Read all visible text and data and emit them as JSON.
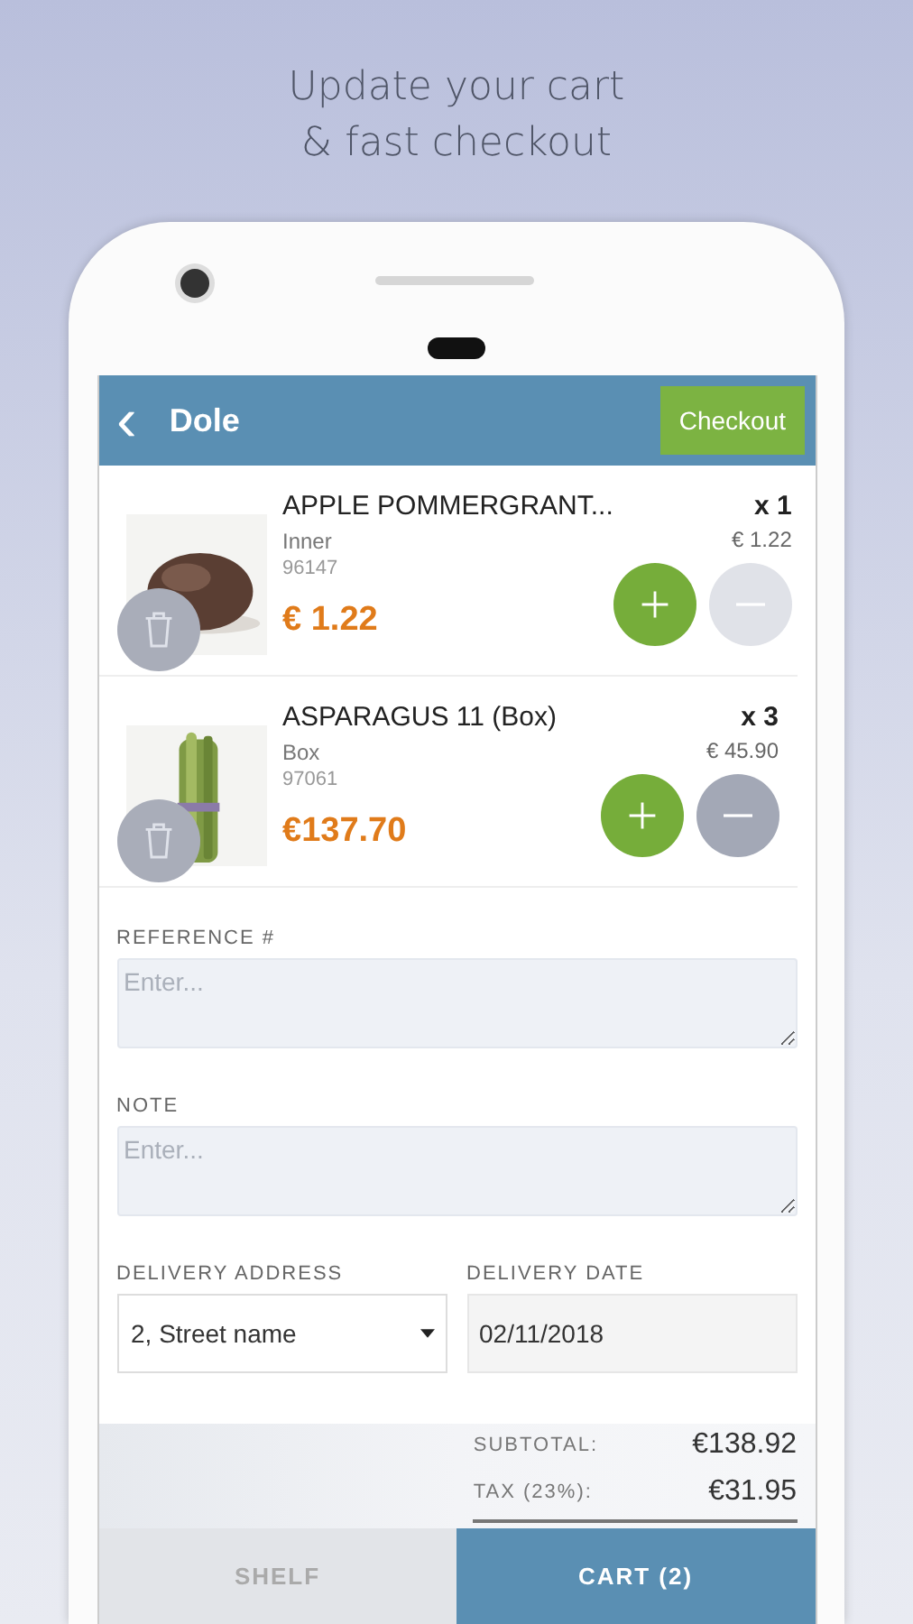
{
  "headline": [
    "Update your cart",
    "& fast checkout"
  ],
  "app_bar": {
    "back_icon": "‹",
    "title": "Dole",
    "checkout_button": "Checkout"
  },
  "cart_items": [
    {
      "name": "APPLE POMMERGRANT...",
      "unit": "Inner",
      "code": "96147",
      "price": "€ 1.22",
      "quantity": "x 1",
      "unit_price": "€ 1.22",
      "minus_disabled": true
    },
    {
      "name": "ASPARAGUS 11 (Box)",
      "unit": "Box",
      "code": "97061",
      "price": "€137.70",
      "quantity": "x 3",
      "unit_price": "€ 45.90",
      "minus_disabled": false
    }
  ],
  "form": {
    "reference": {
      "label": "REFERENCE #",
      "placeholder": "Enter..."
    },
    "note": {
      "label": "NOTE",
      "placeholder": "Enter..."
    },
    "delivery_address": {
      "label": "DELIVERY ADDRESS",
      "value": "2, Street name"
    },
    "delivery_date": {
      "label": "DELIVERY DATE",
      "value": "02/11/2018"
    }
  },
  "summary": [
    {
      "label": "SUBTOTAL:",
      "value": "€138.92"
    },
    {
      "label": "TAX (23%):",
      "value": "€31.95"
    }
  ],
  "tabs": [
    {
      "label": "SHELF",
      "selected": false
    },
    {
      "label": "CART (2)",
      "selected": true
    }
  ]
}
